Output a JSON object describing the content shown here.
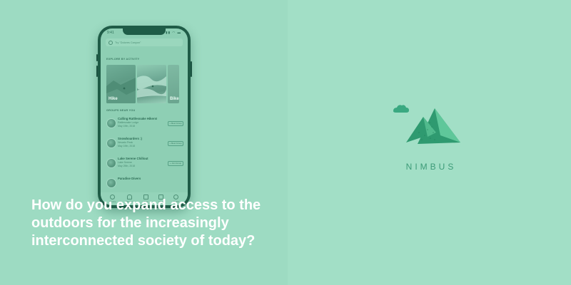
{
  "phone": {
    "status_time": "9:41",
    "status_icons": "▮▮ ◠ ▬",
    "search_placeholder": "Try \"Dolores Canyon\"",
    "explore_heading": "EXPLORE BY ACTIVITY",
    "activities": [
      {
        "label": "Hike"
      },
      {
        "label": ""
      },
      {
        "label": "Bike"
      }
    ],
    "groups_heading": "GROUPS NEAR YOU",
    "groups": [
      {
        "title": "Calling Rattlesnake Hikers!",
        "location": "Rattlesnake Lodge",
        "date": "May 19th, 2018",
        "action": "+ Meet Group"
      },
      {
        "title": "Snowboarders :)",
        "location": "Nevado Peak",
        "date": "May 19th, 2018",
        "action": "+ Meet Group"
      },
      {
        "title": "Lake Serene Chillout",
        "location": "Lake Serene",
        "date": "May 25th, 2018",
        "action": "+ Join Group"
      },
      {
        "title": "Paradise Divers",
        "location": "",
        "date": "",
        "action": ""
      }
    ],
    "tabs": [
      {
        "label": "Explore",
        "icon": "compass-icon"
      },
      {
        "label": "Weather",
        "icon": "cloud-icon"
      },
      {
        "label": "Trips",
        "icon": "map-icon"
      },
      {
        "label": "Inbox",
        "icon": "mail-icon"
      },
      {
        "label": "Profile",
        "icon": "user-icon"
      }
    ]
  },
  "headline": "How do you expand access to the outdoors for the increasingly interconnected society of today?",
  "brand": {
    "name": "NIMBUS",
    "colors": {
      "mountain_dark": "#2f9a70",
      "mountain_light": "#5fc79a",
      "cloud": "#3aa981"
    }
  }
}
